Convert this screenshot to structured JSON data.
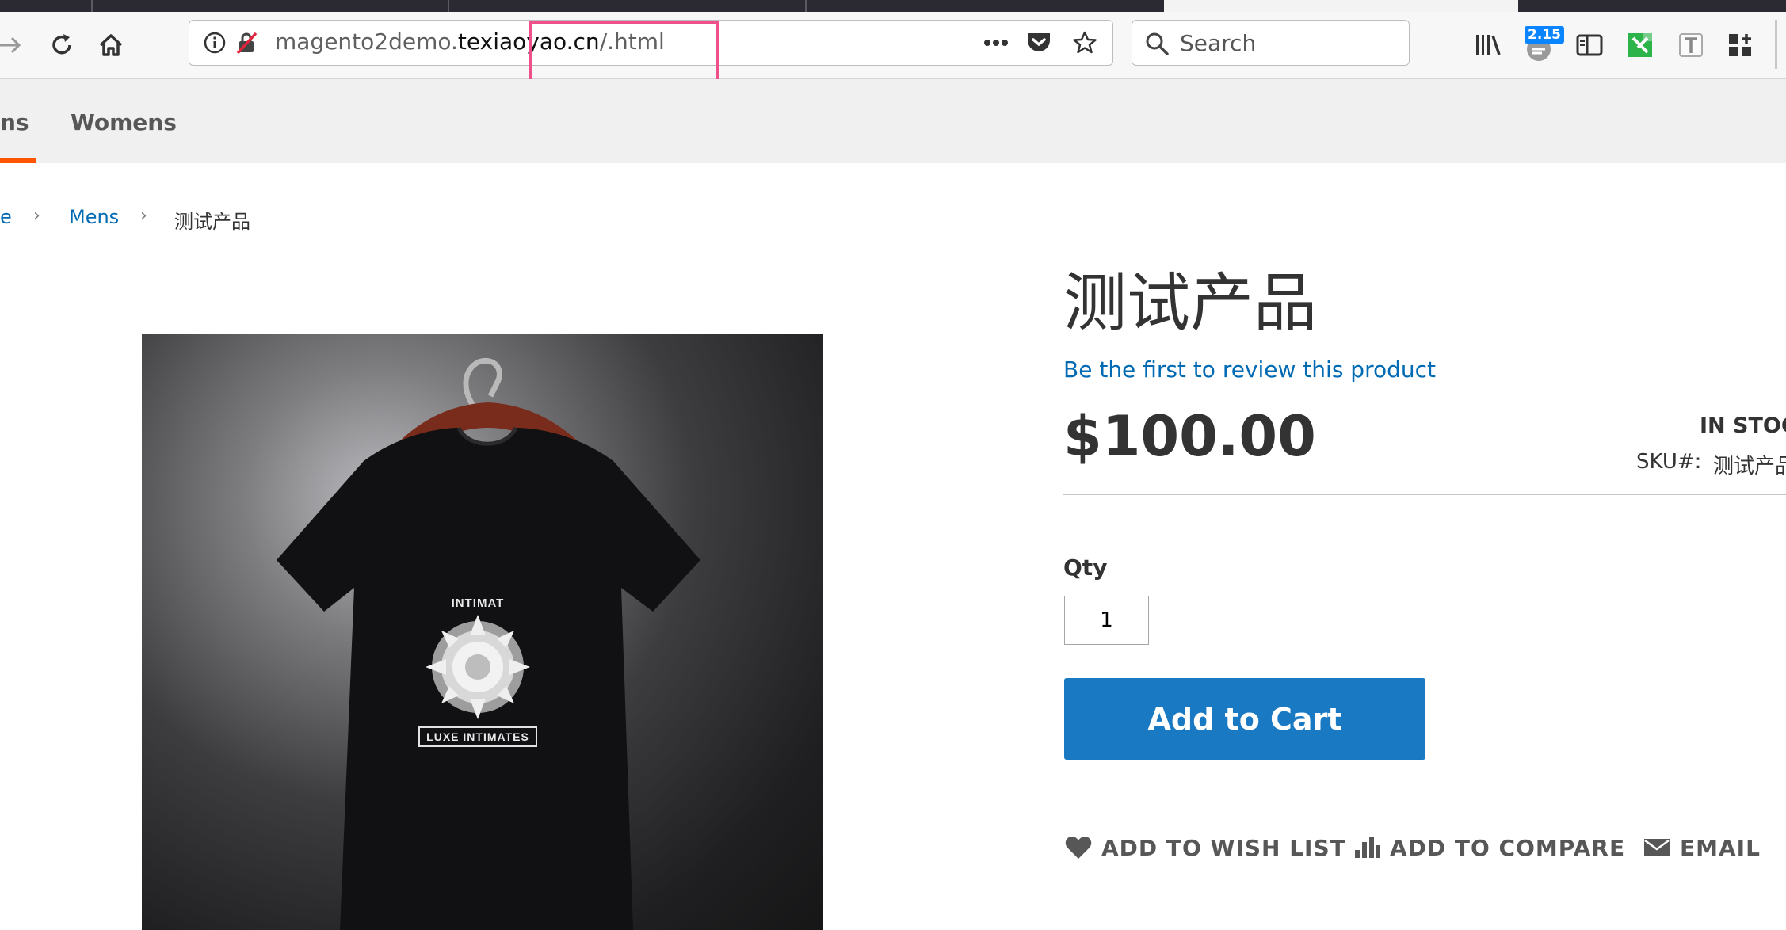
{
  "browser": {
    "url_prefix": "magento2demo.",
    "url_host": "texiaoyao.cn",
    "url_suffix": "/.html",
    "search_placeholder": "Search",
    "badge_count": "2.15"
  },
  "nav": {
    "items": [
      "ns",
      "Womens"
    ]
  },
  "breadcrumbs": {
    "items": [
      "e",
      "Mens",
      "测试产品"
    ]
  },
  "product": {
    "title": "测试产品",
    "review_link": "Be the first to review this product",
    "price": "$100.00",
    "stock": "IN STOC",
    "sku_label": "SKU#:",
    "sku_value": "测试产品",
    "qty_label": "Qty",
    "qty_value": "1",
    "add_to_cart": "Add to Cart",
    "image": {
      "text_top": "INTIMAT",
      "text_bottom": "LUXE INTIMATES"
    }
  },
  "actions": {
    "wishlist": "ADD TO WISH LIST",
    "compare": "ADD TO COMPARE",
    "email": "EMAIL"
  },
  "colors": {
    "accent_blue": "#1979c3",
    "link_blue": "#006bb4",
    "nav_underline": "#ff5501",
    "highlight": "#f0508a"
  }
}
